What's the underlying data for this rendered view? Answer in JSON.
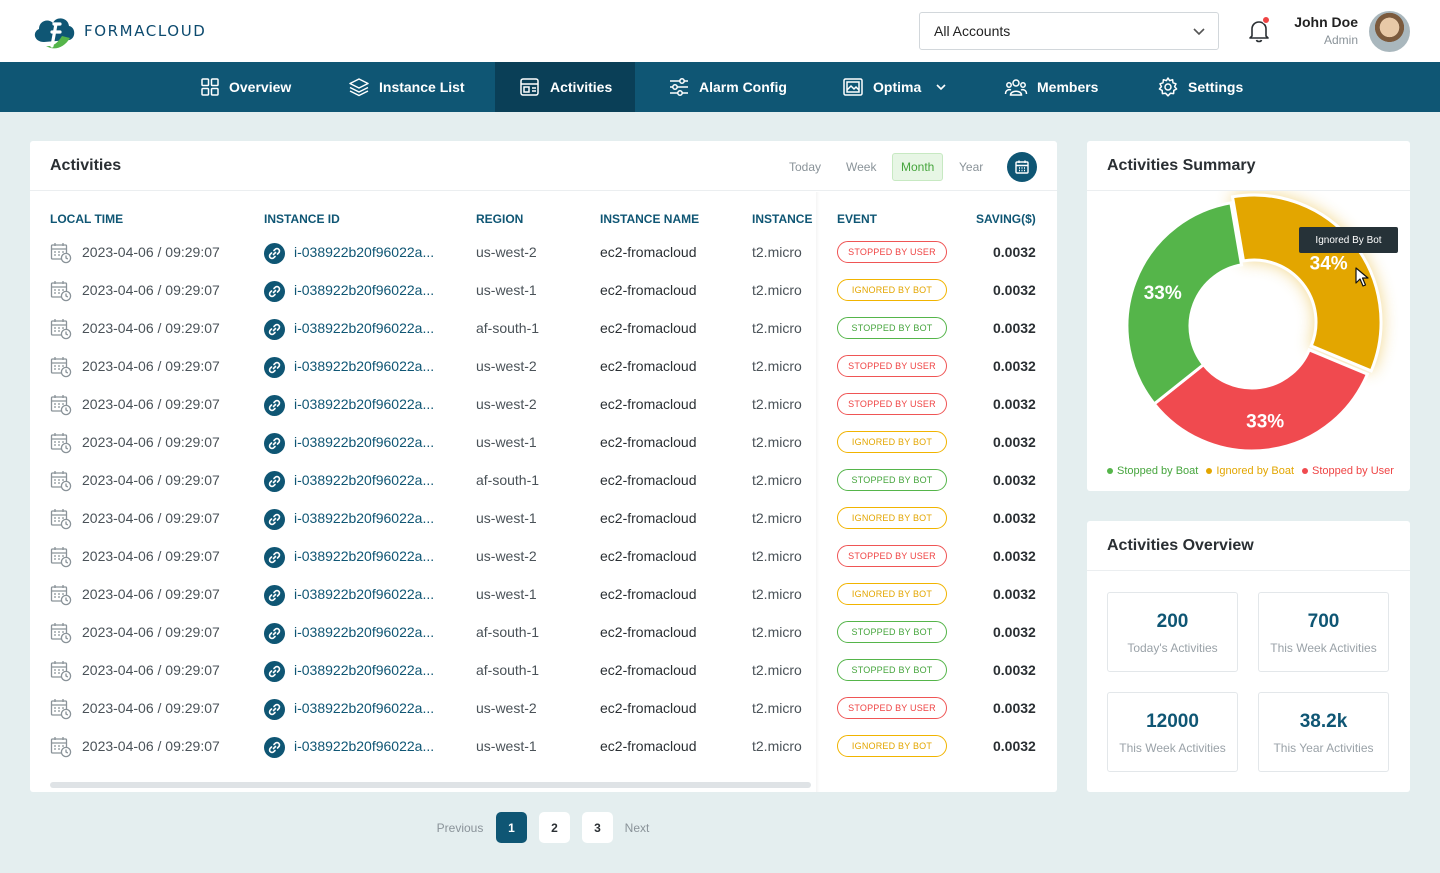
{
  "brand": {
    "name": "FORMACLOUD"
  },
  "header": {
    "account_select": "All Accounts",
    "user_name": "John Doe",
    "user_role": "Admin"
  },
  "nav": [
    {
      "label": "Overview",
      "icon": "grid-icon"
    },
    {
      "label": "Instance List",
      "icon": "layers-icon"
    },
    {
      "label": "Activities",
      "icon": "activities-icon",
      "active": true
    },
    {
      "label": "Alarm Config",
      "icon": "sliders-icon"
    },
    {
      "label": "Optima",
      "icon": "image-frame-icon",
      "dropdown": true
    },
    {
      "label": "Members",
      "icon": "users-icon"
    },
    {
      "label": "Settings",
      "icon": "gear-icon"
    }
  ],
  "activities": {
    "title": "Activities",
    "periods": [
      "Today",
      "Week",
      "Month",
      "Year"
    ],
    "selected_period": "Month",
    "columns": [
      "LOCAL TIME",
      "INSTANCE ID",
      "REGION",
      "INSTANCE NAME",
      "INSTANCE",
      "EVENT",
      "SAVING($)"
    ],
    "rows": [
      {
        "time": "2023-04-06 / 09:29:07",
        "id": "i-038922b20f96022a...",
        "region": "us-west-2",
        "name": "ec2-fromacloud",
        "type": "t2.micro",
        "event": "STOPPED BY USER",
        "saving": "0.0032"
      },
      {
        "time": "2023-04-06 / 09:29:07",
        "id": "i-038922b20f96022a...",
        "region": "us-west-1",
        "name": "ec2-fromacloud",
        "type": "t2.micro",
        "event": "IGNORED BY BOT",
        "saving": "0.0032"
      },
      {
        "time": "2023-04-06 / 09:29:07",
        "id": "i-038922b20f96022a...",
        "region": "af-south-1",
        "name": "ec2-fromacloud",
        "type": "t2.micro",
        "event": "STOPPED BY BOT",
        "saving": "0.0032"
      },
      {
        "time": "2023-04-06 / 09:29:07",
        "id": "i-038922b20f96022a...",
        "region": "us-west-2",
        "name": "ec2-fromacloud",
        "type": "t2.micro",
        "event": "STOPPED BY USER",
        "saving": "0.0032"
      },
      {
        "time": "2023-04-06 / 09:29:07",
        "id": "i-038922b20f96022a...",
        "region": "us-west-2",
        "name": "ec2-fromacloud",
        "type": "t2.micro",
        "event": "STOPPED BY USER",
        "saving": "0.0032"
      },
      {
        "time": "2023-04-06 / 09:29:07",
        "id": "i-038922b20f96022a...",
        "region": "us-west-1",
        "name": "ec2-fromacloud",
        "type": "t2.micro",
        "event": "IGNORED BY BOT",
        "saving": "0.0032"
      },
      {
        "time": "2023-04-06 / 09:29:07",
        "id": "i-038922b20f96022a...",
        "region": "af-south-1",
        "name": "ec2-fromacloud",
        "type": "t2.micro",
        "event": "STOPPED BY BOT",
        "saving": "0.0032"
      },
      {
        "time": "2023-04-06 / 09:29:07",
        "id": "i-038922b20f96022a...",
        "region": "us-west-1",
        "name": "ec2-fromacloud",
        "type": "t2.micro",
        "event": "IGNORED BY BOT",
        "saving": "0.0032"
      },
      {
        "time": "2023-04-06 / 09:29:07",
        "id": "i-038922b20f96022a...",
        "region": "us-west-2",
        "name": "ec2-fromacloud",
        "type": "t2.micro",
        "event": "STOPPED BY USER",
        "saving": "0.0032"
      },
      {
        "time": "2023-04-06 / 09:29:07",
        "id": "i-038922b20f96022a...",
        "region": "us-west-1",
        "name": "ec2-fromacloud",
        "type": "t2.micro",
        "event": "IGNORED BY BOT",
        "saving": "0.0032"
      },
      {
        "time": "2023-04-06 / 09:29:07",
        "id": "i-038922b20f96022a...",
        "region": "af-south-1",
        "name": "ec2-fromacloud",
        "type": "t2.micro",
        "event": "STOPPED BY BOT",
        "saving": "0.0032"
      },
      {
        "time": "2023-04-06 / 09:29:07",
        "id": "i-038922b20f96022a...",
        "region": "af-south-1",
        "name": "ec2-fromacloud",
        "type": "t2.micro",
        "event": "STOPPED BY BOT",
        "saving": "0.0032"
      },
      {
        "time": "2023-04-06 / 09:29:07",
        "id": "i-038922b20f96022a...",
        "region": "us-west-2",
        "name": "ec2-fromacloud",
        "type": "t2.micro",
        "event": "STOPPED BY USER",
        "saving": "0.0032"
      },
      {
        "time": "2023-04-06 / 09:29:07",
        "id": "i-038922b20f96022a...",
        "region": "us-west-1",
        "name": "ec2-fromacloud",
        "type": "t2.micro",
        "event": "IGNORED BY BOT",
        "saving": "0.0032"
      }
    ]
  },
  "pagination": {
    "previous": "Previous",
    "pages": [
      "1",
      "2",
      "3"
    ],
    "current": "1",
    "next": "Next"
  },
  "summary": {
    "title": "Activities Summary",
    "tooltip": "Ignored By Bot",
    "legend": [
      "Stopped by Boat",
      "Ignored by Boat",
      "Stopped by User"
    ]
  },
  "chart_data": {
    "type": "pie",
    "categories": [
      "Stopped by Boat",
      "Ignored by Boat",
      "Stopped by User"
    ],
    "values": [
      33,
      34,
      33
    ],
    "labels": [
      "33%",
      "34%",
      "33%"
    ],
    "colors": [
      "#55b54a",
      "#e3a600",
      "#f04a4f"
    ]
  },
  "overview": {
    "title": "Activities Overview",
    "stats": [
      {
        "value": "200",
        "label": "Today's Activities"
      },
      {
        "value": "700",
        "label": "This Week Activities"
      },
      {
        "value": "12000",
        "label": "This Week Activities"
      },
      {
        "value": "38.2k",
        "label": "This Year Activities"
      }
    ]
  },
  "colors": {
    "primary": "#0f5674",
    "primary_dark": "#0a3f57",
    "background": "#e4eeef",
    "user": "#ef4444",
    "ignored": "#e3a600",
    "bot": "#46a53d"
  }
}
